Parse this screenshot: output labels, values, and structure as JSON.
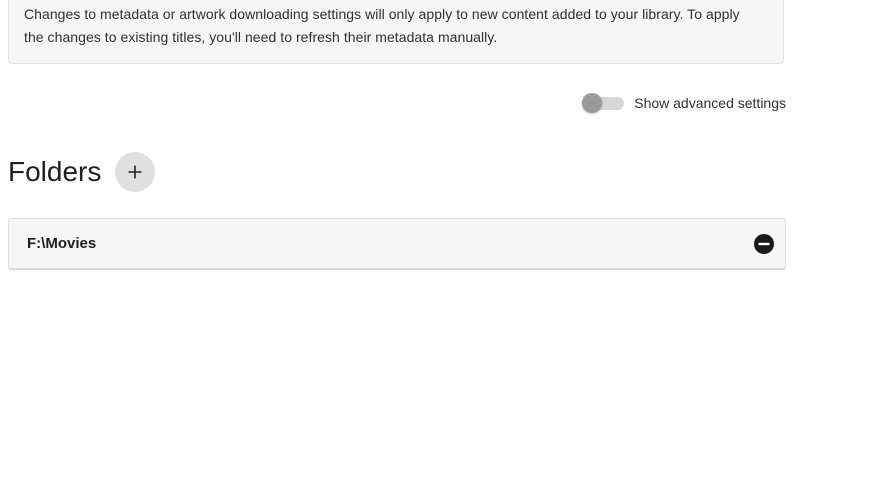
{
  "info": {
    "line1": "Changes to metadata or artwork downloading settings will only apply to new content added to your library. To apply",
    "line2": "the changes to existing titles, you'll need to refresh their metadata manually."
  },
  "advanced_toggle": {
    "label": "Show advanced settings",
    "checked": false
  },
  "folders": {
    "title": "Folders",
    "add_icon": "plus-icon",
    "items": [
      {
        "path": "F:\\Movies",
        "remove_icon": "minus-circle-icon"
      }
    ]
  },
  "colors": {
    "info_bg": "#f6f6f8",
    "add_button_bg": "#e0e0e0",
    "toggle_thumb": "#9a9a9a",
    "toggle_track": "#d6d6d6",
    "remove_icon": "#1a1a1a"
  }
}
